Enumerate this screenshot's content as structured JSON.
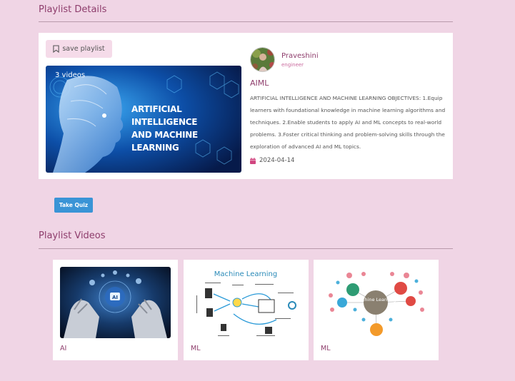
{
  "details": {
    "heading": "Playlist Details",
    "save_label": "save playlist",
    "video_count": "3 videos",
    "thumbnail_title_line1": "Artificial Intelligence",
    "thumbnail_title_line2": "and Machine Learning",
    "author_name": "Praveshini",
    "author_role": "engineer",
    "playlist_title": "AIML",
    "description": "ARTIFICIAL INTELLIGENCE AND MACHINE LEARNING OBJECTIVES: 1.Equip learners with foundational knowledge in machine learning algorithms and techniques. 2.Enable students to apply AI and ML concepts to real-world problems. 3.Foster critical thinking and problem-solving skills through the exploration of advanced AI and ML topics.",
    "date": "2024-04-14"
  },
  "quiz": {
    "label": "Take Quiz"
  },
  "videos": {
    "heading": "Playlist Videos",
    "items": [
      {
        "label": "AI"
      },
      {
        "label": "ML",
        "thumb_title": "Machine Learning"
      },
      {
        "label": "ML",
        "thumb_center": "Machine Learning"
      }
    ]
  },
  "colors": {
    "accent": "#8e3d6c",
    "background": "#f0d5e5",
    "button_blue": "#3a94d6"
  }
}
